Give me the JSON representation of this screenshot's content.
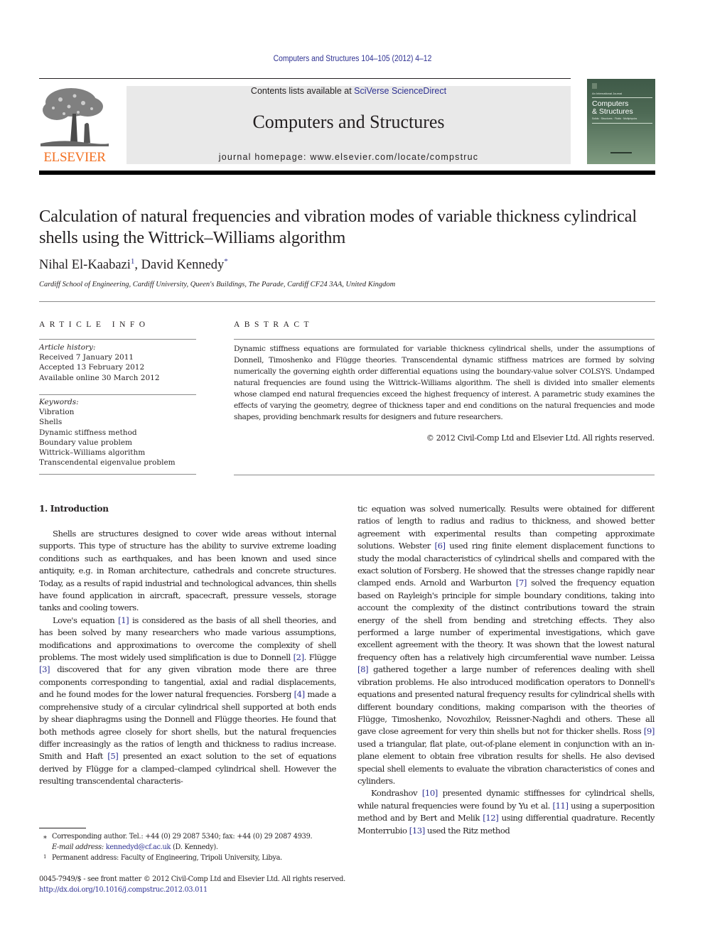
{
  "header": {
    "journal_ref": "Computers and Structures 104–105 (2012) 4–12",
    "contents_prefix": "Contents lists available at ",
    "contents_link": "SciVerse ScienceDirect",
    "journal_title": "Computers and Structures",
    "homepage_label": "journal homepage: ",
    "homepage_url": "www.elsevier.com/locate/compstruc",
    "publisher": "ELSEVIER",
    "cover": {
      "small": "An International Journal",
      "title_line1": "Computers",
      "title_line2": "& Structures",
      "subtitle": "Solids · Structures · Fluids · Multiphysics"
    }
  },
  "article": {
    "title": "Calculation of natural frequencies and vibration modes of variable thickness cylindrical shells using the Wittrick–Williams algorithm",
    "authors": [
      {
        "name": "Nihal El-Kaabazi",
        "mark": "1"
      },
      {
        "name": "David Kennedy",
        "mark": "*"
      }
    ],
    "author_separator": ", ",
    "affiliation": "Cardiff School of Engineering, Cardiff University, Queen's Buildings, The Parade, Cardiff CF24 3AA, United Kingdom"
  },
  "article_info": {
    "heading": "ARTICLE INFO",
    "history_label": "Article history:",
    "history": [
      "Received 7 January 2011",
      "Accepted 13 February 2012",
      "Available online 30 March 2012"
    ],
    "keywords_label": "Keywords:",
    "keywords": [
      "Vibration",
      "Shells",
      "Dynamic stiffness method",
      "Boundary value problem",
      "Wittrick–Williams algorithm",
      "Transcendental eigenvalue problem"
    ]
  },
  "abstract": {
    "heading": "ABSTRACT",
    "text": "Dynamic stiffness equations are formulated for variable thickness cylindrical shells, under the assumptions of Donnell, Timoshenko and Flügge theories. Transcendental dynamic stiffness matrices are formed by solving numerically the governing eighth order differential equations using the boundary-value solver COLSYS. Undamped natural frequencies are found using the Wittrick–Williams algorithm. The shell is divided into smaller elements whose clamped end natural frequencies exceed the highest frequency of interest. A parametric study examines the effects of varying the geometry, degree of thickness taper and end conditions on the natural frequencies and mode shapes, providing benchmark results for designers and future researchers.",
    "copyright": "© 2012 Civil-Comp Ltd and Elsevier Ltd. All rights reserved."
  },
  "body": {
    "section_heading": "1. Introduction",
    "left_paragraphs": [
      [
        {
          "t": "Shells are structures designed to cover wide areas without internal supports. This type of structure has the ability to survive extreme loading conditions such as earthquakes, and has been known and used since antiquity, e.g. in Roman architecture, cathedrals and concrete structures. Today, as a results of rapid industrial and technological advances, thin shells have found application in aircraft, spacecraft, pressure vessels, storage tanks and cooling towers."
        }
      ],
      [
        {
          "t": "Love's equation "
        },
        {
          "c": "[1]"
        },
        {
          "t": " is considered as the basis of all shell theories, and has been solved by many researchers who made various assumptions, modifications and approximations to overcome the complexity of shell problems. The most widely used simplification is due to Donnell "
        },
        {
          "c": "[2]"
        },
        {
          "t": ". Flügge "
        },
        {
          "c": "[3]"
        },
        {
          "t": " discovered that for any given vibration mode there are three components corresponding to tangential, axial and radial displacements, and he found modes for the lower natural frequencies. Forsberg "
        },
        {
          "c": "[4]"
        },
        {
          "t": " made a comprehensive study of a circular cylindrical shell supported at both ends by shear diaphragms using the Donnell and Flügge theories. He found that both methods agree closely for short shells, but the natural frequencies differ increasingly as the ratios of length and thickness to radius increase. Smith and Haft "
        },
        {
          "c": "[5]"
        },
        {
          "t": " presented an exact solution to the set of equations derived by Flügge for a clamped–clamped cylindrical shell. However the resulting transcendental characteris-"
        }
      ]
    ],
    "right_paragraphs": [
      [
        {
          "t": "tic equation was solved numerically. Results were obtained for different ratios of length to radius and radius to thickness, and showed better agreement with experimental results than competing approximate solutions. Webster "
        },
        {
          "c": "[6]"
        },
        {
          "t": " used ring finite element displacement functions to study the modal characteristics of cylindrical shells and compared with the exact solution of Forsberg. He showed that the stresses change rapidly near clamped ends. Arnold and Warburton "
        },
        {
          "c": "[7]"
        },
        {
          "t": " solved the frequency equation based on Rayleigh's principle for simple boundary conditions, taking into account the complexity of the distinct contributions toward the strain energy of the shell from bending and stretching effects. They also performed a large number of experimental investigations, which gave excellent agreement with the theory. It was shown that the lowest natural frequency often has a relatively high circumferential wave number. Leissa "
        },
        {
          "c": "[8]"
        },
        {
          "t": " gathered together a large number of references dealing with shell vibration problems. He also introduced modification operators to Donnell's equations and presented natural frequency results for cylindrical shells with different boundary conditions, making comparison with the theories of Flügge, Timoshenko, Novozhilov, Reissner-Naghdi and others. These all gave close agreement for very thin shells but not for thicker shells. Ross "
        },
        {
          "c": "[9]"
        },
        {
          "t": " used a triangular, flat plate, out-of-plane element in conjunction with an in-plane element to obtain free vibration results for shells. He also devised special shell elements to evaluate the vibration characteristics of cones and cylinders."
        }
      ],
      [
        {
          "t": "Kondrashov "
        },
        {
          "c": "[10]"
        },
        {
          "t": " presented dynamic stiffnesses for cylindrical shells, while natural frequencies were found by Yu et al. "
        },
        {
          "c": "[11]"
        },
        {
          "t": " using a superposition method and by Bert and Melik "
        },
        {
          "c": "[12]"
        },
        {
          "t": " using differential quadrature. Recently Monterrubio "
        },
        {
          "c": "[13]"
        },
        {
          "t": " used the Ritz method"
        }
      ]
    ]
  },
  "footnotes": {
    "corresponding_mark": "⁎",
    "corresponding_text": "Corresponding author. Tel.: +44 (0) 29 2087 5340; fax: +44 (0) 29 2087 4939.",
    "email_label": "E-mail address: ",
    "email": "kennedyd@cf.ac.uk",
    "email_suffix": " (D. Kennedy).",
    "permanent_mark": "1",
    "permanent_text": "Permanent address: Faculty of Engineering, Tripoli University, Libya."
  },
  "front_matter": {
    "issn_line": "0045-7949/$ - see front matter © 2012 Civil-Comp Ltd and Elsevier Ltd. All rights reserved.",
    "doi": "http://dx.doi.org/10.1016/j.compstruc.2012.03.011"
  }
}
